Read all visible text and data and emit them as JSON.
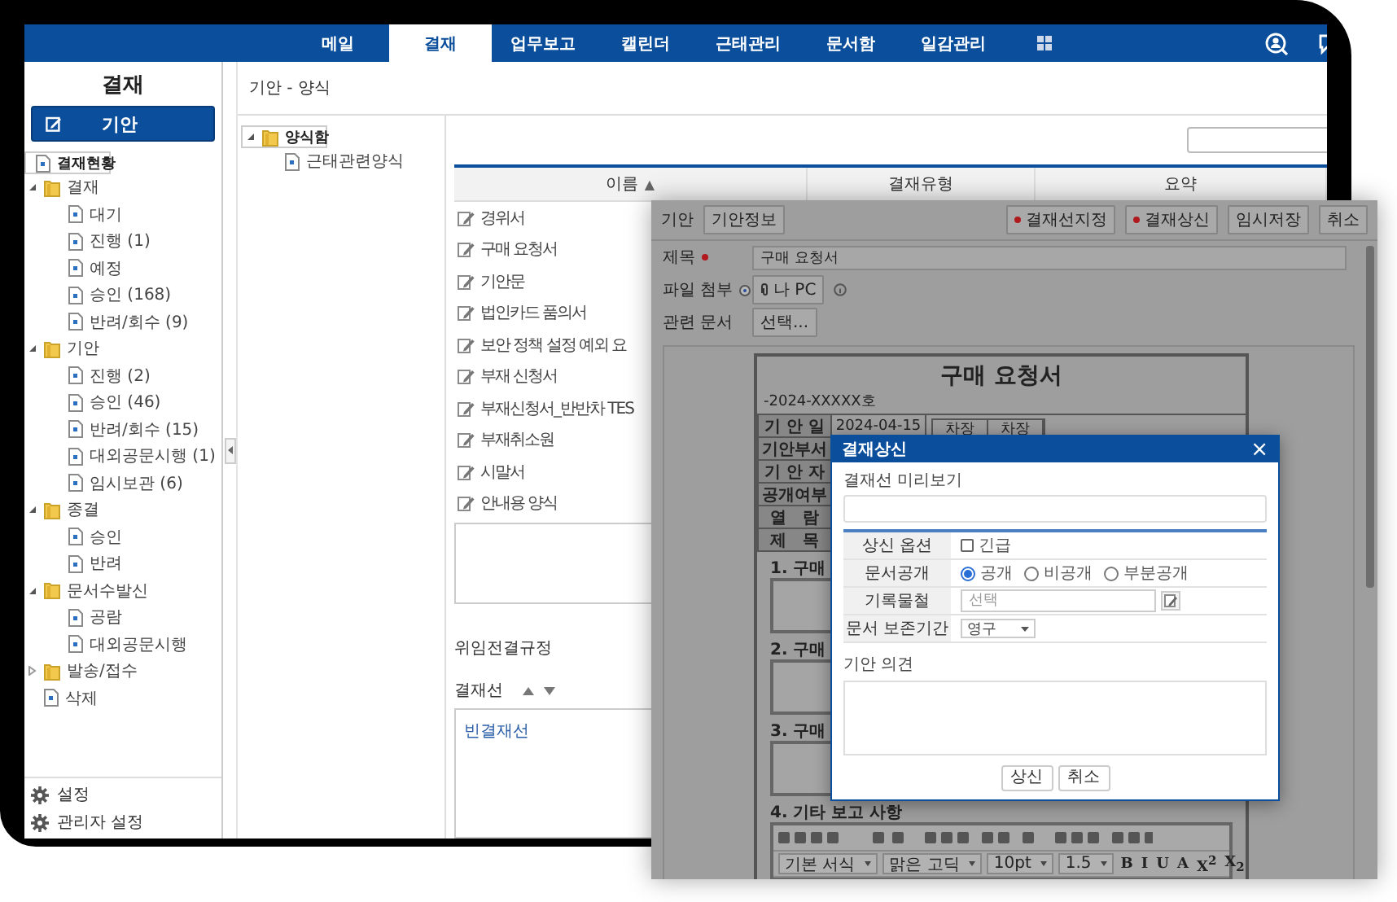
{
  "nav": {
    "items": [
      {
        "label": "메일",
        "selected": false
      },
      {
        "label": "결재",
        "selected": true
      },
      {
        "label": "업무보고",
        "selected": false
      },
      {
        "label": "캘린더",
        "selected": false
      },
      {
        "label": "근태관리",
        "selected": false
      },
      {
        "label": "문서함",
        "selected": false
      },
      {
        "label": "일감관리",
        "selected": false
      }
    ]
  },
  "sidebar": {
    "title": "결재",
    "compose_button": "기안",
    "tree": [
      {
        "label": "결재현황",
        "kind": "doc",
        "selected": true
      },
      {
        "label": "결재",
        "kind": "folder",
        "expanded": true,
        "selected": false,
        "children": [
          {
            "label": "대기",
            "kind": "doc",
            "selected": false
          },
          {
            "label": "진행 (1)",
            "kind": "doc",
            "selected": false
          },
          {
            "label": "예정",
            "kind": "doc",
            "selected": false
          },
          {
            "label": "승인 (168)",
            "kind": "doc",
            "selected": false
          },
          {
            "label": "반려/회수 (9)",
            "kind": "doc",
            "selected": false
          }
        ]
      },
      {
        "label": "기안",
        "kind": "folder",
        "expanded": true,
        "selected": false,
        "children": [
          {
            "label": "진행 (2)",
            "kind": "doc",
            "selected": false
          },
          {
            "label": "승인 (46)",
            "kind": "doc",
            "selected": false
          },
          {
            "label": "반려/회수 (15)",
            "kind": "doc",
            "selected": false
          },
          {
            "label": "대외공문시행 (1)",
            "kind": "doc",
            "selected": false
          },
          {
            "label": "임시보관 (6)",
            "kind": "doc",
            "selected": false
          }
        ]
      },
      {
        "label": "종결",
        "kind": "folder",
        "expanded": true,
        "selected": false,
        "children": [
          {
            "label": "승인",
            "kind": "doc",
            "selected": false
          },
          {
            "label": "반려",
            "kind": "doc",
            "selected": false
          }
        ]
      },
      {
        "label": "문서수발신",
        "kind": "folder",
        "expanded": true,
        "selected": false,
        "children": [
          {
            "label": "공람",
            "kind": "doc",
            "selected": false
          },
          {
            "label": "대외공문시행",
            "kind": "doc",
            "selected": false
          }
        ]
      },
      {
        "label": "발송/접수",
        "kind": "folder",
        "expanded": false,
        "selected": false
      },
      {
        "label": "삭제",
        "kind": "doc",
        "selected": false
      }
    ],
    "footer": [
      "설정",
      "관리자 설정"
    ]
  },
  "breadcrumb": "기안 - 양식",
  "form_tree": [
    {
      "label": "양식함",
      "kind": "folder",
      "expanded": true,
      "selected": true,
      "children": [
        {
          "label": "근태관련양식",
          "kind": "doc",
          "selected": false
        }
      ]
    }
  ],
  "form_list": {
    "columns": [
      {
        "label": "이름",
        "sort_icon": "▲"
      },
      {
        "label": "결재유형"
      },
      {
        "label": "요약"
      }
    ],
    "rows": [
      "경위서",
      "구매 요청서",
      "기안문",
      "법인카드 품의서",
      "보안 정책 설정 예외 요",
      "부재 신청서",
      "부재신청서_반반차 TES",
      "부재취소원",
      "시말서",
      "안내용 양식"
    ]
  },
  "delegation": {
    "title": "위임전결규정"
  },
  "approval_line": {
    "title": "결재선",
    "items": [
      "빈결재선"
    ]
  },
  "draft_window": {
    "title": "기안",
    "info_button": "기안정보",
    "actions": [
      {
        "label": "결재선지정",
        "marked": true
      },
      {
        "label": "결재상신",
        "marked": true
      },
      {
        "label": "임시저장",
        "marked": false
      },
      {
        "label": "취소",
        "marked": false
      }
    ],
    "fields": [
      {
        "kind": "text",
        "label": "제목",
        "required": true,
        "value": "구매 요청서"
      },
      {
        "kind": "file",
        "label": "파일 첨부",
        "required": false,
        "button": "나 PC"
      },
      {
        "kind": "button",
        "label": "관련 문서",
        "required": false,
        "button": "선택..."
      }
    ],
    "document": {
      "title": "구매 요청서",
      "doc_number": "-2024-XXXXX호",
      "info_rows": [
        {
          "label": "기 안 일",
          "value": "2024-04-15"
        },
        {
          "label": "기안부서"
        },
        {
          "label": "기 안 자"
        },
        {
          "label": "공개여부"
        },
        {
          "label": "열   람"
        },
        {
          "label": "제   목"
        }
      ],
      "approvers": [
        "차장",
        "차장"
      ],
      "sections": [
        "1. 구매",
        "2. 구매",
        "3. 구매",
        "4. 기타 보고 사항"
      ],
      "editor": {
        "selects": [
          "기본 서식",
          "맑은 고딕",
          "10pt",
          "1.5"
        ],
        "format_buttons": [
          "B",
          "I",
          "U",
          "A",
          "X$^{2}$",
          "X$_{2}$"
        ]
      }
    }
  },
  "dialog": {
    "title": "결재상신",
    "close": "×",
    "preview_label": "결재선 미리보기",
    "options": [
      {
        "kind": "checkbox",
        "label": "상신 옵션",
        "choices": [
          {
            "label": "긴급",
            "checked": false
          }
        ]
      },
      {
        "kind": "radio",
        "label": "문서공개",
        "choices": [
          {
            "label": "공개",
            "selected": true
          },
          {
            "label": "비공개",
            "selected": false
          },
          {
            "label": "부분공개",
            "selected": false
          }
        ]
      },
      {
        "kind": "picker",
        "label": "기록물철",
        "placeholder": "선택"
      },
      {
        "kind": "select",
        "label": "문서 보존기간",
        "value": "영구"
      }
    ],
    "comment_label": "기안 의견",
    "buttons": [
      "상신",
      "취소"
    ]
  }
}
